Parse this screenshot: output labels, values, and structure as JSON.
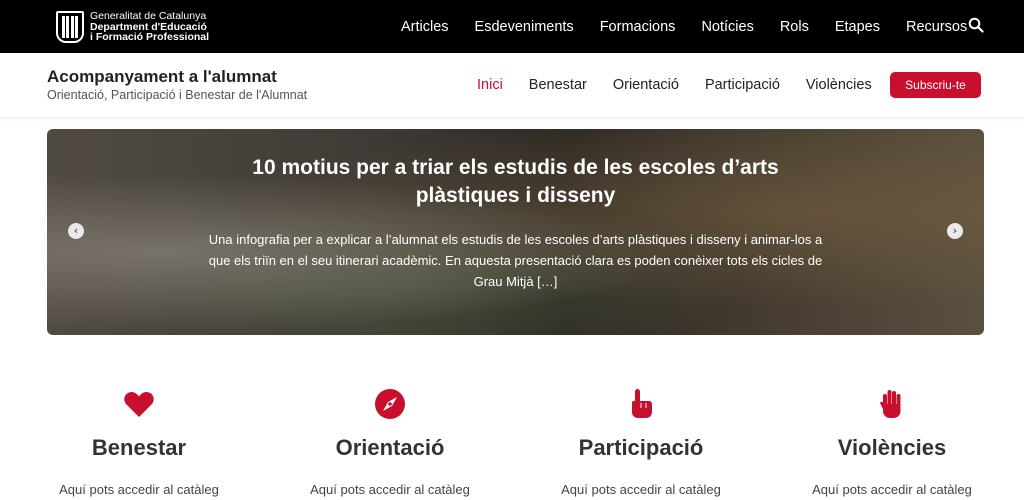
{
  "brand": {
    "line1": "Generalitat de Catalunya",
    "line2": "Department d'Educació",
    "line3": "i Formació Professional"
  },
  "top_nav": [
    "Articles",
    "Esdeveniments",
    "Formacions",
    "Notícies",
    "Rols",
    "Etapes",
    "Recursos"
  ],
  "site": {
    "title": "Acompanyament a l'alumnat",
    "subtitle": "Orientació, Participació i Benestar de l'Alumnat"
  },
  "main_nav": [
    "Inici",
    "Benestar",
    "Orientació",
    "Participació",
    "Violències"
  ],
  "subscribe_label": "Subscriu-te",
  "hero": {
    "title": "10 motius per a triar els estudis de les escoles d’arts plàstiques i disseny",
    "text": "Una infografia per a explicar a l’alumnat els estudis de les escoles d’arts plàstiques i disseny i animar-los a que els triïn en el seu itinerari acadèmic. En aquesta presentació clara es poden conèixer tots els cicles de Grau Mitjà […]",
    "prev_icon": "chevron-left-icon",
    "next_icon": "chevron-right-icon"
  },
  "categories": [
    {
      "title": "Benestar",
      "text": "Aquí pots accedir al catàleg",
      "icon": "heart-icon"
    },
    {
      "title": "Orientació",
      "text": "Aquí pots accedir al catàleg",
      "icon": "compass-icon"
    },
    {
      "title": "Participació",
      "text": "Aquí pots accedir al catàleg",
      "icon": "pointing-hand-icon"
    },
    {
      "title": "Violències",
      "text": "Aquí pots accedir al catàleg",
      "icon": "stop-hand-icon"
    }
  ],
  "colors": {
    "accent": "#c8102e",
    "topbar": "#000000"
  }
}
